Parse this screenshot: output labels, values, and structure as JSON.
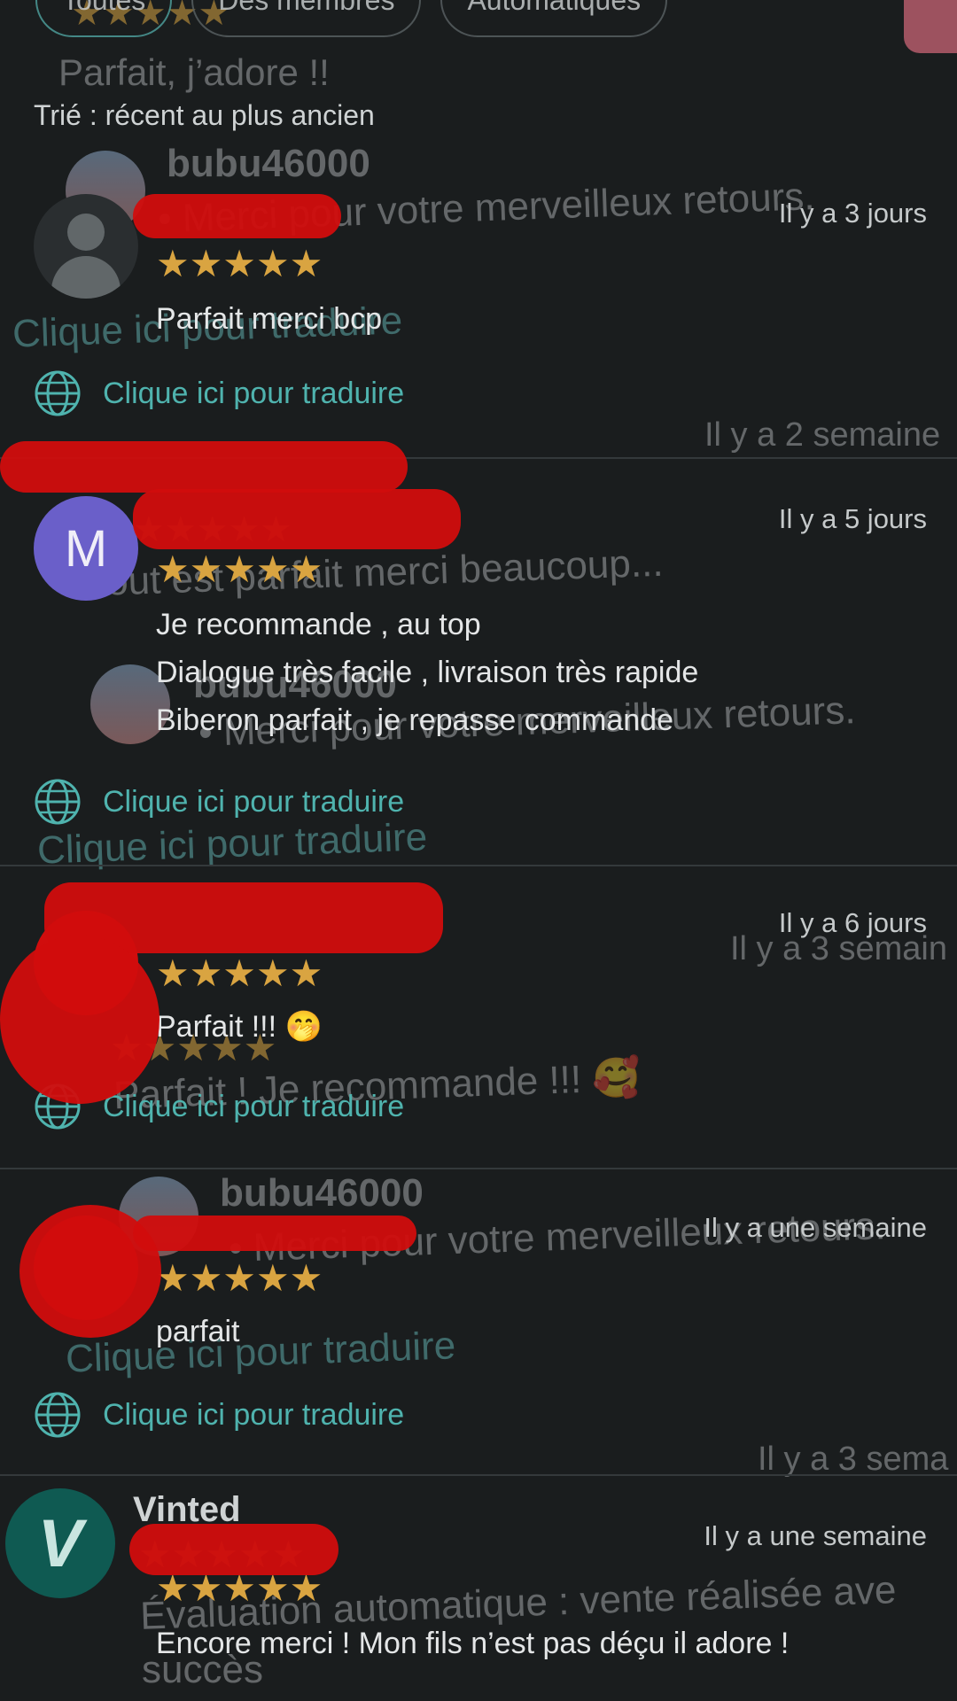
{
  "filters": {
    "chips": [
      {
        "label": "Toutes",
        "active": true
      },
      {
        "label": "Des membres",
        "active": false
      },
      {
        "label": "Automatiques",
        "active": false
      }
    ]
  },
  "sort_label": "Trié : récent au plus ancien",
  "reviews": [
    {
      "username": "",
      "time": "Il y a 3 jours",
      "rating": 5,
      "stars": "★★★★★",
      "comment": [
        "Parfait merci bcp"
      ],
      "translate_label": "Clique ici pour traduire",
      "avatar": "default-avatar"
    },
    {
      "username": "",
      "time": "Il y a 5 jours",
      "rating": 5,
      "stars": "★★★★★",
      "comment": [
        "Je recommande , au top",
        "Dialogue très facile , livraison très rapide",
        "Biberon parfait , je repasse commande"
      ],
      "translate_label": "Clique ici pour traduire",
      "avatar_letter": "M"
    },
    {
      "username": "",
      "time": "Il y a 6 jours",
      "rating": 5,
      "stars": "★★★★★",
      "comment": [
        "Parfait !!! 🤭"
      ],
      "translate_label": "Clique ici pour traduire",
      "avatar": "redacted"
    },
    {
      "username": "",
      "time": "Il y a une semaine",
      "rating": 5,
      "stars": "★★★★★",
      "comment": [
        "parfait"
      ],
      "translate_label": "Clique ici pour traduire",
      "avatar": "redacted"
    },
    {
      "username": "Vinted",
      "time": "Il y a une semaine",
      "rating": 5,
      "stars": "★★★★★",
      "comment": [
        "Encore merci ! Mon fils n’est pas déçu il adore !"
      ],
      "avatar_letter": "V"
    }
  ],
  "ghost_overlay": {
    "title": "Parfait, j’adore !!",
    "user": "bubu46000",
    "reply": "• Merci pour votre merveilleux retours.",
    "time_1": "Il y a 2 semaine",
    "time_2": "Il y a 3 semain",
    "time_3": "Il y a 3 sema",
    "review_1": "Tout est parfait merci beaucoup...",
    "review_2": "Parfait ! Je recommande !!! 🥰",
    "translate": "Clique ici pour traduire",
    "auto_1": "Évaluation automatique : vente réalisée ave",
    "auto_2": "succès",
    "stars": "★★★★★"
  },
  "colors": {
    "background": "#1a1d1e",
    "star": "#d9a441",
    "accent": "#4fb3ae",
    "redaction": "#d10d0d"
  }
}
